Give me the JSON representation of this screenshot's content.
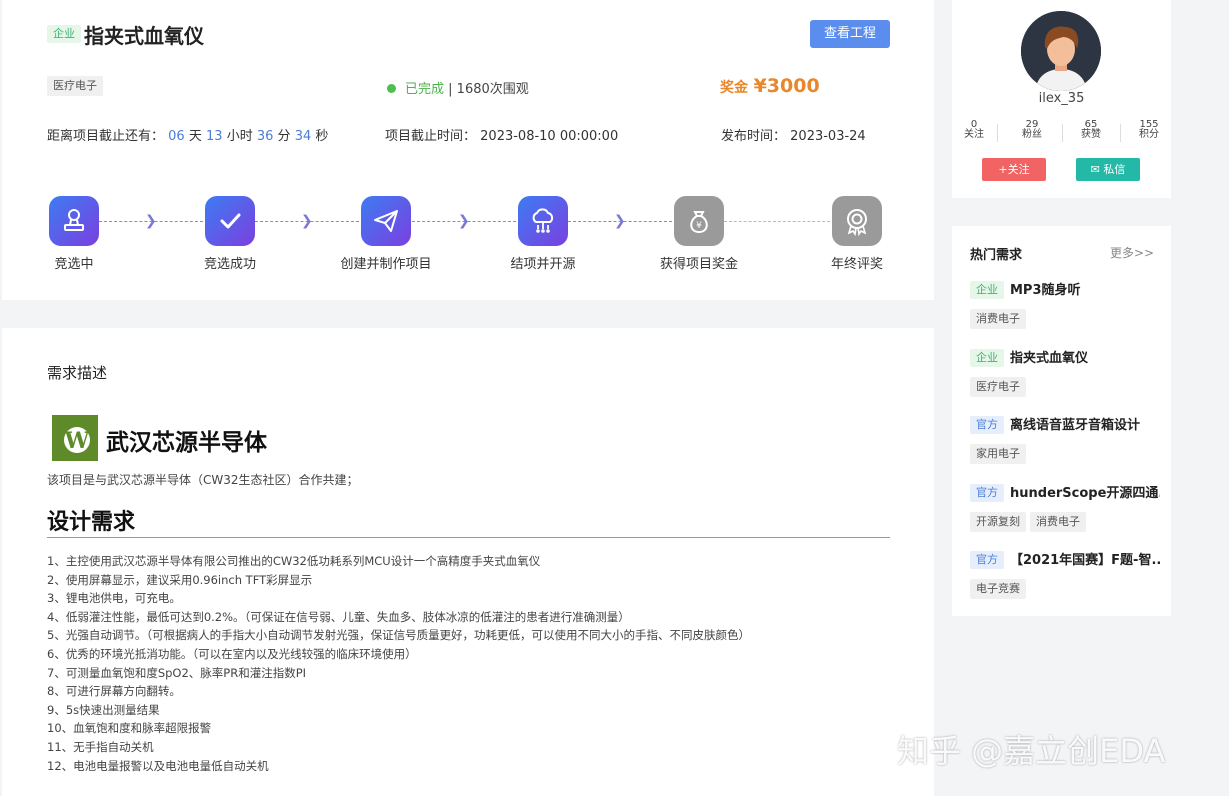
{
  "project": {
    "type_badge": "企业",
    "title": "指夹式血氧仪",
    "view_button": "查看工程",
    "category": "医疗电子",
    "status": "已完成",
    "views": "| 1680次围观",
    "prize_label": "奖金",
    "prize_amount": "¥3000",
    "countdown": {
      "label": "距离项目截止还有：",
      "days": "06",
      "days_unit": "天",
      "hours": "13",
      "hours_unit": "小时",
      "minutes": "36",
      "minutes_unit": "分",
      "seconds": "34",
      "seconds_unit": "秒"
    },
    "deadline_label": "项目截止时间：",
    "deadline": "2023-08-10 00:00:00",
    "publish_label": "发布时间：",
    "publish": "2023-03-24"
  },
  "steps": [
    {
      "label": "竞选中",
      "icon": "stamp-icon"
    },
    {
      "label": "竞选成功",
      "icon": "check-icon"
    },
    {
      "label": "创建并制作项目",
      "icon": "paper-plane-icon"
    },
    {
      "label": "结项并开源",
      "icon": "cloud-share-icon"
    },
    {
      "label": "获得项目奖金",
      "icon": "money-bag-icon"
    },
    {
      "label": "年终评奖",
      "icon": "award-medal-icon"
    }
  ],
  "description": {
    "heading": "需求描述",
    "logo_text": "武汉芯源半导体",
    "coop_text": "该项目是与武汉芯源半导体（CW32生态社区）合作共建；",
    "design_heading": "设计需求",
    "requirements": [
      "1、主控使用武汉芯源半导体有限公司推出的CW32低功耗系列MCU设计一个高精度手夹式血氧仪",
      "2、使用屏幕显示，建议采用0.96inch TFT彩屏显示",
      "3、锂电池供电，可充电。",
      "4、低弱灌注性能，最低可达到0.2%。（可保证在信号弱、儿童、失血多、肢体冰凉的低灌注的患者进行准确测量）",
      "5、光强自动调节。（可根据病人的手指大小自动调节发射光强，保证信号质量更好，功耗更低，可以使用不同大小的手指、不同皮肤颜色）",
      "6、优秀的环境光抵消功能。（可以在室内以及光线较强的临床环境使用）",
      "7、可测量血氧饱和度SpO2、脉率PR和灌注指数PI",
      "8、可进行屏幕方向翻转。",
      "9、5s快速出测量结果",
      "10、血氧饱和度和脉率超限报警",
      "11、无手指自动关机",
      "12、电池电量报警以及电池电量低自动关机"
    ]
  },
  "watermark": "知乎 @嘉立创EDA",
  "profile": {
    "username": "ilex_35",
    "stats": [
      {
        "value": "0",
        "label": "关注"
      },
      {
        "value": "29",
        "label": "粉丝"
      },
      {
        "value": "65",
        "label": "获赞"
      },
      {
        "value": "155",
        "label": "积分"
      }
    ],
    "follow_button": "+关注",
    "message_button": "✉ 私信"
  },
  "hot": {
    "title": "热门需求",
    "more": "更多>>",
    "items": [
      {
        "badge": "企业",
        "badge_type": "ent",
        "name": "MP3随身听",
        "tags": [
          "消费电子"
        ]
      },
      {
        "badge": "企业",
        "badge_type": "ent",
        "name": "指夹式血氧仪",
        "tags": [
          "医疗电子"
        ]
      },
      {
        "badge": "官方",
        "badge_type": "off",
        "name": "离线语音蓝牙音箱设计",
        "tags": [
          "家用电子"
        ]
      },
      {
        "badge": "官方",
        "badge_type": "off",
        "name": "hunderScope开源四通...",
        "tags": [
          "开源复刻",
          "消费电子"
        ]
      },
      {
        "badge": "官方",
        "badge_type": "off",
        "name": "【2021年国赛】F题-智...",
        "tags": [
          "电子竞赛"
        ]
      }
    ]
  },
  "colors": {
    "accent_blue": "#5b8def",
    "prize_orange": "#e8872b",
    "status_green": "#4cb34c",
    "follow_red": "#f26464",
    "message_teal": "#23b9a6"
  }
}
